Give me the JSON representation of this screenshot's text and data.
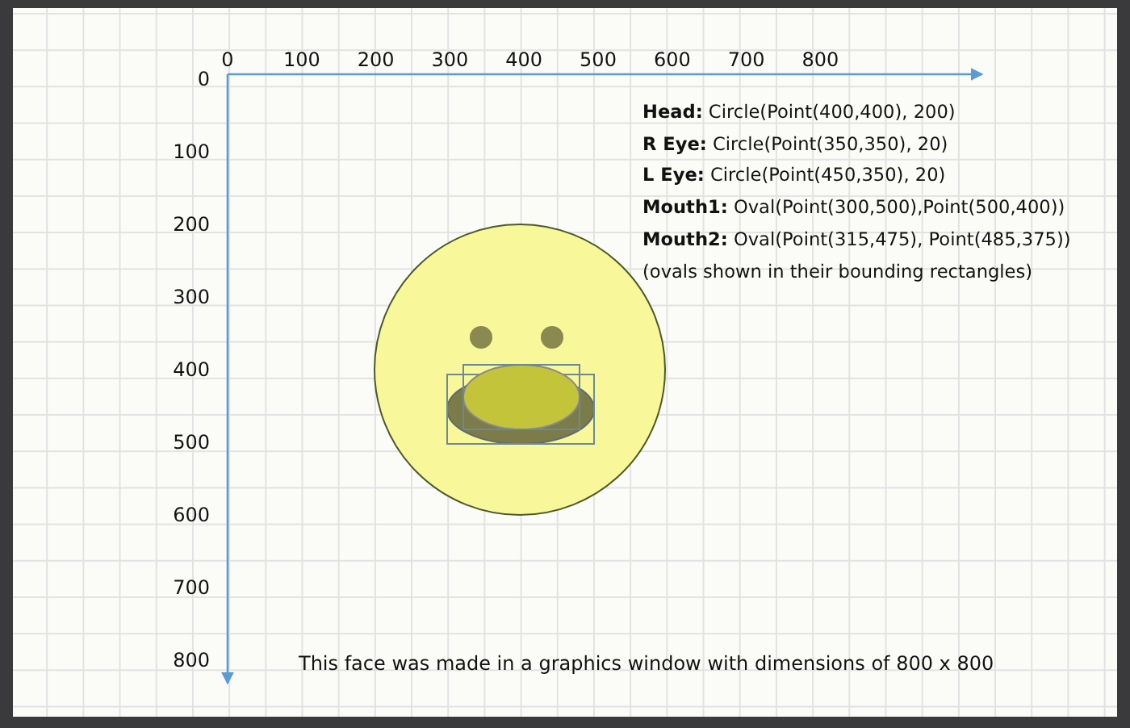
{
  "x_axis": {
    "ticks": [
      "0",
      "100",
      "200",
      "300",
      "400",
      "500",
      "600",
      "700",
      "800"
    ]
  },
  "y_axis": {
    "ticks": [
      "0",
      "100",
      "200",
      "300",
      "400",
      "500",
      "600",
      "700",
      "800"
    ]
  },
  "legend": [
    {
      "text": "**Head:** Circle(Point(400,400), 200)"
    },
    {
      "text": "**R Eye:** Circle(Point(350,350), 20)"
    },
    {
      "text": "**L Eye:** Circle(Point(450,350), 20)"
    },
    {
      "text": "**Mouth1:** Oval(Point(300,500),Point(500,400))"
    },
    {
      "text": "**Mouth2:** Oval(Point(315,475), Point(485,375))"
    },
    {
      "text": "(ovals shown in their bounding rectangles)"
    }
  ],
  "caption": "This face was made in a graphics window with dimensions of 800 x 800"
}
